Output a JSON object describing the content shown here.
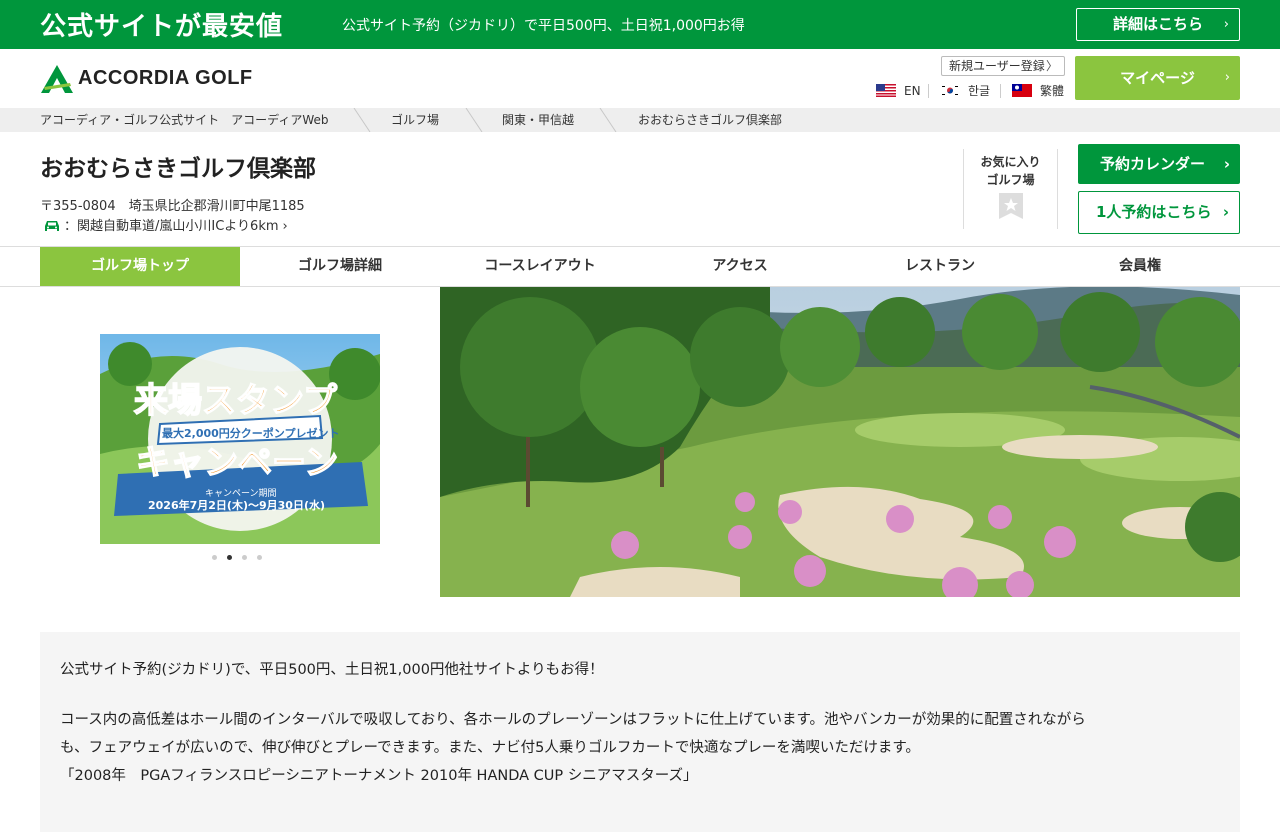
{
  "promo": {
    "title": "公式サイトが最安値",
    "text": "公式サイト予約（ジカドリ）で平日500円、土日祝1,000円お得",
    "button": "詳細はこちら"
  },
  "header": {
    "logo_text": "ACCORDIA GOLF",
    "register": "新規ユーザー登録",
    "languages": [
      "EN",
      "한글",
      "繁體"
    ],
    "mypage": "マイページ"
  },
  "breadcrumb": [
    "アコーディア・ゴルフ公式サイト　アコーディアWeb",
    "ゴルフ場",
    "関東・甲信越",
    "おおむらさきゴルフ倶楽部"
  ],
  "club": {
    "name": "おおむらさきゴルフ倶楽部",
    "address": "〒355-0804　埼玉県比企郡滑川町中尾1185",
    "access_label": "：",
    "access": "関越自動車道/嵐山小川ICより6km",
    "favorite_line1": "お気に入り",
    "favorite_line2": "ゴルフ場",
    "calendar_button": "予約カレンダー",
    "single_button": "1人予約はこちら"
  },
  "tabs": [
    "ゴルフ場トップ",
    "ゴルフ場詳細",
    "コースレイアウト",
    "アクセス",
    "レストラン",
    "会員権"
  ],
  "banner": {
    "title_line1": "来場スタンプ",
    "sub": "最大2,000円分クーポンプレゼント",
    "title_line2": "キャンペーン",
    "period_label": "キャンペーン期間",
    "period": "2026年7月2日(木)～9月30日(水)"
  },
  "carousel": {
    "count": 4,
    "active": 1
  },
  "description": {
    "line1": "公式サイト予約(ジカドリ)で、平日500円、土日祝1,000円他社サイトよりもお得！",
    "line2": "コース内の高低差はホール間のインターバルで吸収しており、各ホールのプレーゾーンはフラットに仕上げています。池やバンカーが効果的に配置されながら",
    "line3": "も、フェアウェイが広いので、伸び伸びとプレーできます。また、ナビ付5人乗りゴルフカートで快適なプレーを満喫いただけます。",
    "line4": "「2008年　PGAフィランスロピーシニアトーナメント 2010年 HANDA CUP シニアマスターズ」"
  },
  "colors": {
    "brand_green": "#00963c",
    "accent_green": "#8bc53f"
  }
}
